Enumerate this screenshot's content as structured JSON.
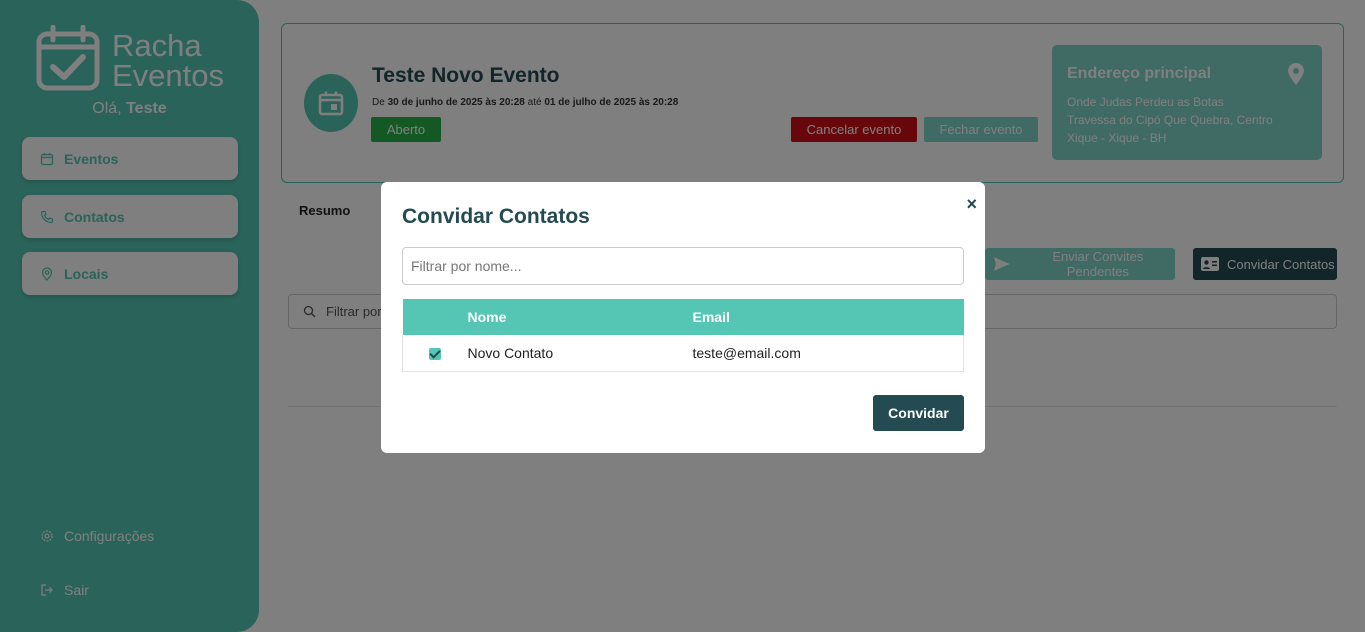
{
  "sidebar": {
    "logo_line1": "Racha",
    "logo_line2": "Eventos",
    "greeting_prefix": "Olá,",
    "user_name": "Teste",
    "items": [
      {
        "label": "Eventos",
        "icon": "calendar-icon"
      },
      {
        "label": "Contatos",
        "icon": "phone-icon"
      },
      {
        "label": "Locais",
        "icon": "map-pin-icon"
      }
    ],
    "settings_label": "Configurações",
    "logout_label": "Sair"
  },
  "event": {
    "title": "Teste Novo Evento",
    "date_prefix": "De",
    "start": "30 de junho de 2025 às 20:28",
    "date_mid": "até",
    "end": "01 de julho de 2025 às 20:28",
    "status": "Aberto",
    "cancel_label": "Cancelar evento",
    "close_label": "Fechar evento"
  },
  "address": {
    "title": "Endereço principal",
    "line1": "Onde Judas Perdeu as Botas",
    "line2": "Travessa do Cipó Que Quebra, Centro",
    "line3": "Xique - Xique - BH"
  },
  "main": {
    "tab_resumo": "Resumo",
    "send_pending_label": "Enviar Convites Pendentes",
    "invite_contacts_label": "Convidar Contatos",
    "filter_placeholder": "Filtrar por"
  },
  "modal": {
    "title": "Convidar Contatos",
    "close_symbol": "×",
    "filter_placeholder": "Filtrar por nome...",
    "columns": [
      "",
      "Nome",
      "Email"
    ],
    "rows": [
      {
        "checked": true,
        "name": "Novo Contato",
        "email": "teste@email.com"
      }
    ],
    "invite_label": "Convidar"
  },
  "colors": {
    "primary": "#55c6b3",
    "dark": "#244b52",
    "status_open": "#28b046",
    "danger": "#d10f17"
  }
}
